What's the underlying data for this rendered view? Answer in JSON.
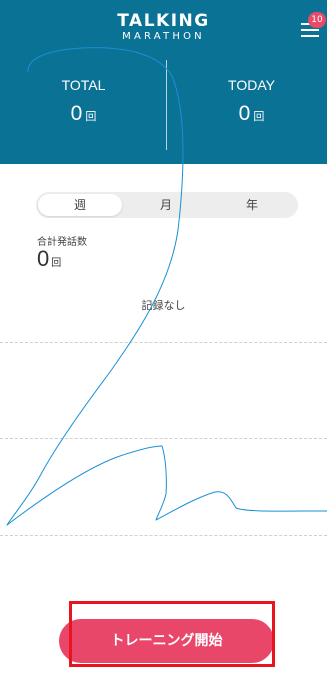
{
  "logo": {
    "line1": "TALKING",
    "line2": "MARATHON"
  },
  "menu": {
    "badge_count": "10",
    "icon": "hamburger-menu-icon"
  },
  "stats": {
    "total": {
      "label": "TOTAL",
      "value": "0",
      "unit": "回"
    },
    "today": {
      "label": "TODAY",
      "value": "0",
      "unit": "回"
    }
  },
  "period_tabs": [
    {
      "label": "週",
      "selected": true
    },
    {
      "label": "月",
      "selected": false
    },
    {
      "label": "年",
      "selected": false
    }
  ],
  "summary": {
    "label": "合計発話数",
    "value": "0",
    "unit": "回"
  },
  "chart": {
    "empty_message": "記録なし"
  },
  "start_button": {
    "label": "トレーニング開始"
  },
  "colors": {
    "header": "#0a7294",
    "accent": "#e8476a",
    "badge": "#e84a6a",
    "annotation_stroke": "#1a8fd6",
    "highlight_box": "#e8141e"
  }
}
